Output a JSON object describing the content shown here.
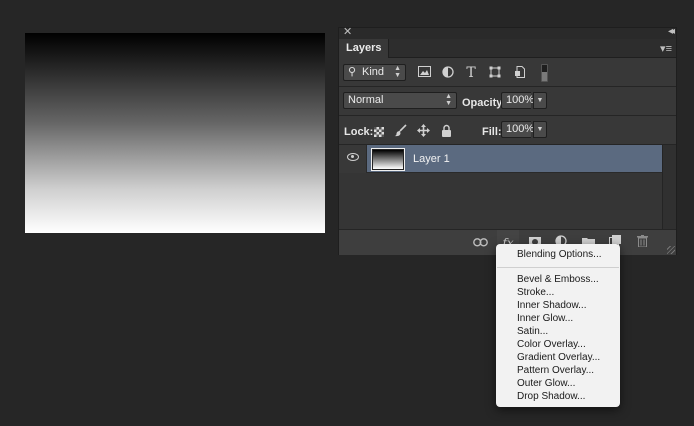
{
  "panel": {
    "close_glyph": "✕",
    "collapse_glyph": "◂◂",
    "tab_label": "Layers",
    "menu_glyph": "▾≡"
  },
  "filter": {
    "kind_label": "Kind",
    "icons": [
      "image-filter-icon",
      "adjustment-filter-icon",
      "type-filter-icon",
      "shape-filter-icon",
      "smart-object-filter-icon"
    ]
  },
  "blend": {
    "mode": "Normal",
    "opacity_label": "Opacity:",
    "opacity_value": "100%"
  },
  "lock": {
    "label": "Lock:",
    "fill_label": "Fill:",
    "fill_value": "100%"
  },
  "layers": [
    {
      "name": "Layer 1",
      "visible": true,
      "selected": true
    }
  ],
  "fx_menu": {
    "items": [
      "Blending Options...",
      "Bevel & Emboss...",
      "Stroke...",
      "Inner Shadow...",
      "Inner Glow...",
      "Satin...",
      "Color Overlay...",
      "Gradient Overlay...",
      "Pattern Overlay...",
      "Outer Glow...",
      "Drop Shadow..."
    ]
  },
  "colors": {
    "background": "#262626",
    "panel": "#383838",
    "selected_layer": "#5b6a80",
    "menu": "#f2f2f2"
  }
}
